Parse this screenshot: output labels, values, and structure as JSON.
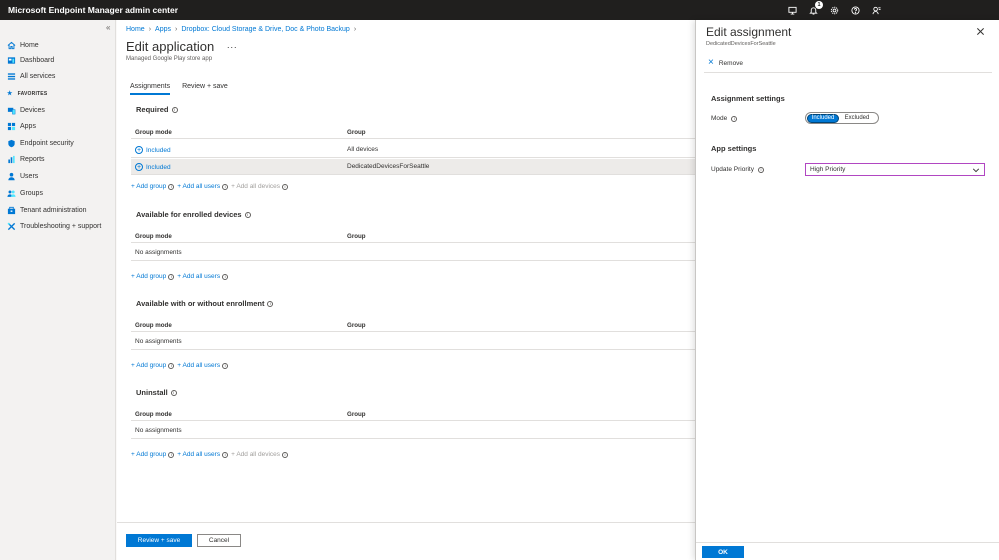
{
  "app": {
    "title": "Microsoft Endpoint Manager admin center",
    "notification_count": "1",
    "topbar_icons": [
      "remote-icon",
      "bell-icon",
      "gear-icon",
      "help-icon",
      "feedback-icon"
    ]
  },
  "sidebar": {
    "collapse_glyph": "«",
    "favorites_label": "FAVORITES",
    "items": [
      {
        "label": "Home",
        "icon": "home-icon"
      },
      {
        "label": "Dashboard",
        "icon": "dashboard-icon"
      },
      {
        "label": "All services",
        "icon": "all-services-icon"
      },
      {
        "label": "Devices",
        "icon": "devices-icon"
      },
      {
        "label": "Apps",
        "icon": "apps-icon"
      },
      {
        "label": "Endpoint security",
        "icon": "shield-icon"
      },
      {
        "label": "Reports",
        "icon": "reports-icon"
      },
      {
        "label": "Users",
        "icon": "users-icon"
      },
      {
        "label": "Groups",
        "icon": "groups-icon"
      },
      {
        "label": "Tenant administration",
        "icon": "tenant-admin-icon"
      },
      {
        "label": "Troubleshooting + support",
        "icon": "troubleshoot-icon"
      }
    ]
  },
  "main": {
    "breadcrumb": [
      "Home",
      "Apps",
      "Dropbox: Cloud Storage & Drive, Doc & Photo Backup"
    ],
    "title": "Edit application",
    "more": "...",
    "subtitle": "Managed Google Play store app",
    "tabs": [
      "Assignments",
      "Review + save"
    ],
    "columns": {
      "group_mode": "Group mode",
      "group": "Group"
    },
    "links": {
      "add_group": "+ Add group",
      "add_all_users": "+ Add all users",
      "add_all_devices": "+ Add all devices"
    },
    "sections": [
      {
        "title": "Required",
        "rows": [
          {
            "mode": "Included",
            "group": "All devices"
          },
          {
            "mode": "Included",
            "group": "DedicatedDevicesForSeattle"
          }
        ]
      },
      {
        "title": "Available for enrolled devices",
        "empty": "No assignments"
      },
      {
        "title": "Available with or without enrollment",
        "empty": "No assignments"
      },
      {
        "title": "Uninstall",
        "empty": "No assignments"
      }
    ],
    "footer": {
      "primary": "Review + save",
      "secondary": "Cancel"
    }
  },
  "panel": {
    "title": "Edit assignment",
    "subtitle": "DedicatedDevicesForSeattle",
    "remove": "Remove",
    "assignment_settings": "Assignment settings",
    "mode_label": "Mode",
    "mode_options": [
      "Included",
      "Excluded"
    ],
    "app_settings": "App settings",
    "priority_label": "Update Priority",
    "priority_value": "High Priority",
    "ok": "OK",
    "accent": "#0078d4",
    "focus_border": "#b146c2"
  }
}
